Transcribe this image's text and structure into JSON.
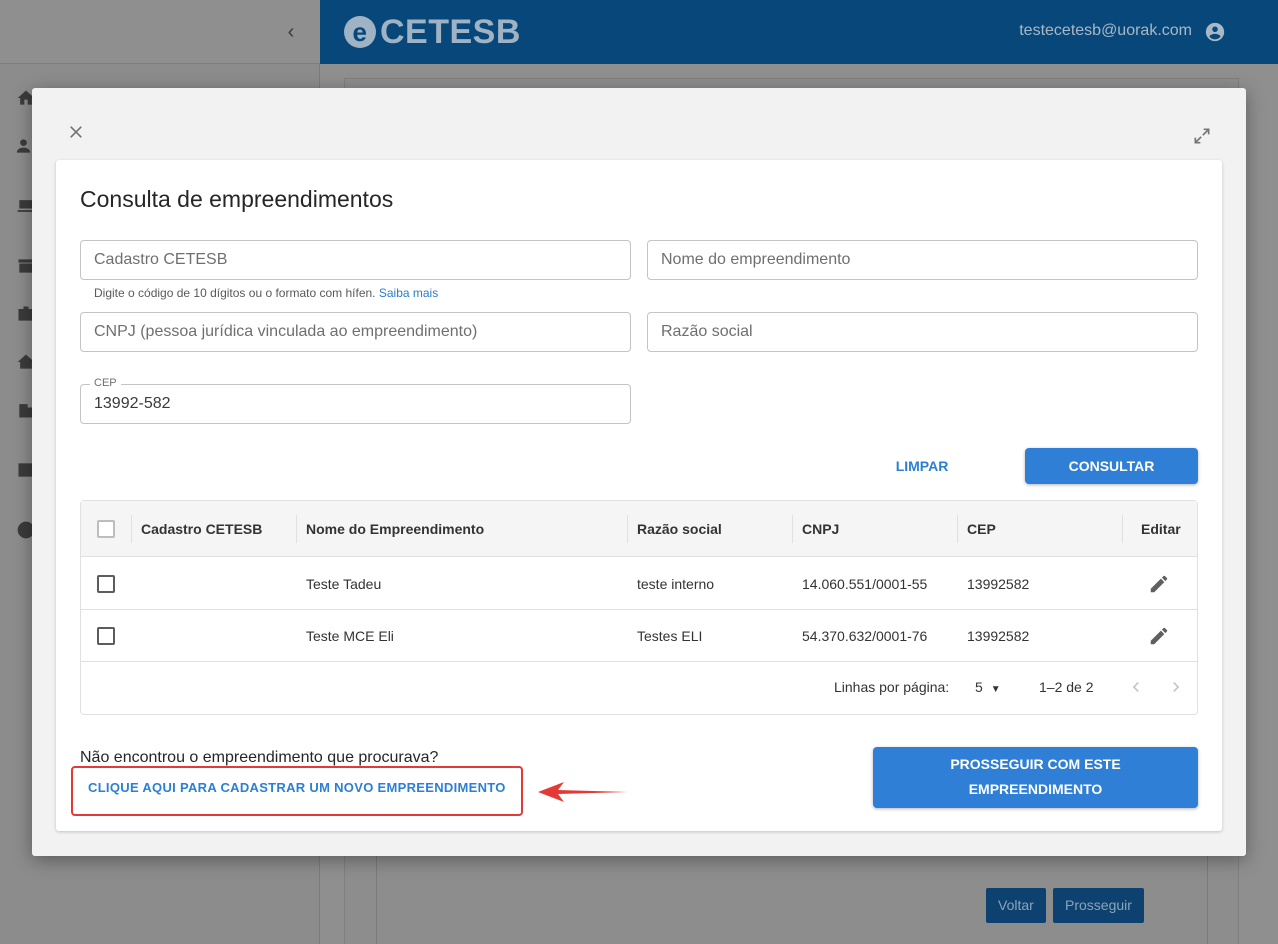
{
  "background": {
    "brand": "CETESB",
    "user_email": "testecetesb@uorak.com",
    "buttons": {
      "back": "Voltar",
      "proceed": "Prosseguir"
    }
  },
  "modal": {
    "title": "Consulta de empreendimentos",
    "fields": {
      "cadastro": {
        "placeholder": "Cadastro CETESB",
        "value": ""
      },
      "nome": {
        "placeholder": "Nome do empreendimento",
        "value": ""
      },
      "cnpj": {
        "placeholder": "CNPJ (pessoa jurídica vinculada ao empreendimento)",
        "value": ""
      },
      "razao": {
        "placeholder": "Razão social",
        "value": ""
      },
      "cep": {
        "label": "CEP",
        "value": "13992-582"
      }
    },
    "helper_text": "Digite o código de 10 dígitos ou o formato com hífen.",
    "helper_link": "Saiba mais",
    "buttons": {
      "clear": "LIMPAR",
      "search": "CONSULTAR"
    },
    "table": {
      "headers": [
        "Cadastro CETESB",
        "Nome do Empreendimento",
        "Razão social",
        "CNPJ",
        "CEP",
        "Editar"
      ],
      "rows": [
        {
          "cadastro": "",
          "nome": "Teste Tadeu",
          "razao": "teste interno",
          "cnpj": "14.060.551/0001-55",
          "cep": "13992582"
        },
        {
          "cadastro": "",
          "nome": "Teste MCE Eli",
          "razao": "Testes ELI",
          "cnpj": "54.370.632/0001-76",
          "cep": "13992582"
        }
      ],
      "footer": {
        "rows_per_page_label": "Linhas por página:",
        "rows_per_page": "5",
        "range": "1–2 de 2"
      }
    },
    "not_found_text": "Não encontrou o empreendimento que procurava?",
    "new_link": "CLIQUE AQUI PARA CADASTRAR UM NOVO EMPREENDIMENTO",
    "proceed_button_line1": "PROSSEGUIR COM ESTE",
    "proceed_button_line2": "EMPREENDIMENTO"
  },
  "colors": {
    "primary": "#2f7fd6",
    "header": "#08477a",
    "annotation": "#e53935"
  }
}
